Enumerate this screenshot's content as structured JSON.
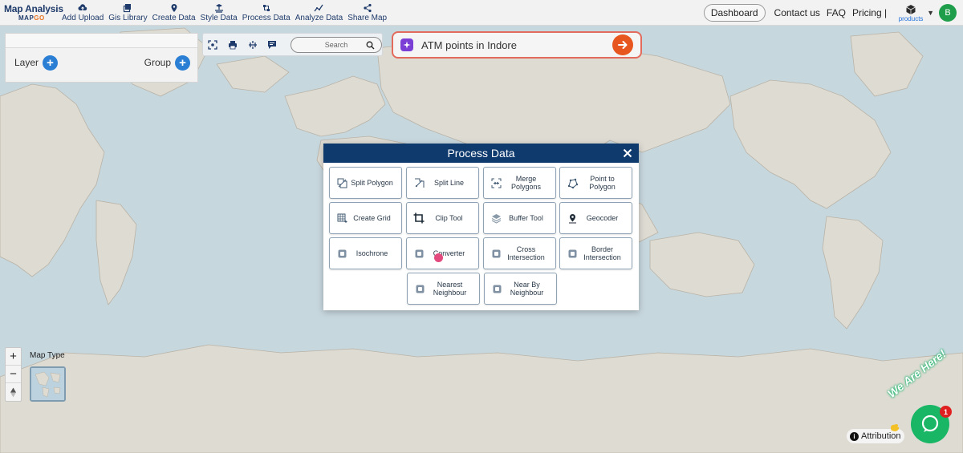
{
  "brand": {
    "name": "Map Analysis",
    "sub_a": "MAP",
    "sub_b": "GO"
  },
  "nav": [
    {
      "label": "Add Upload",
      "icon": "cloud-upload-icon"
    },
    {
      "label": "Gis Library",
      "icon": "layers-icon"
    },
    {
      "label": "Create Data",
      "icon": "map-pin-icon"
    },
    {
      "label": "Style Data",
      "icon": "paint-icon"
    },
    {
      "label": "Process Data",
      "icon": "process-icon"
    },
    {
      "label": "Analyze Data",
      "icon": "analyze-icon"
    },
    {
      "label": "Share Map",
      "icon": "share-icon"
    }
  ],
  "nav_right": {
    "dashboard": "Dashboard",
    "contact": "Contact us",
    "faq": "FAQ",
    "pricing": "Pricing |",
    "products": "products",
    "avatar_initial": "B"
  },
  "layer_panel": {
    "layer_label": "Layer",
    "group_label": "Group"
  },
  "toolbar": {
    "search_placeholder": "Search"
  },
  "ai_bar": {
    "text": "ATM points in Indore"
  },
  "modal": {
    "title": "Process Data",
    "tools": [
      {
        "label": "Split Polygon",
        "icon": "split-polygon-icon"
      },
      {
        "label": "Split Line",
        "icon": "split-line-icon"
      },
      {
        "label": "Merge Polygons",
        "icon": "merge-polygons-icon"
      },
      {
        "label": "Point to Polygon",
        "icon": "point-to-polygon-icon"
      },
      {
        "label": "Create Grid",
        "icon": "grid-icon"
      },
      {
        "label": "Clip Tool",
        "icon": "crop-icon"
      },
      {
        "label": "Buffer Tool",
        "icon": "buffer-icon"
      },
      {
        "label": "Geocoder",
        "icon": "geocoder-pin-icon"
      },
      {
        "label": "Isochrone",
        "icon": "isochrone-icon"
      },
      {
        "label": "Converter",
        "icon": "converter-icon"
      },
      {
        "label": "Cross Intersection",
        "icon": "cross-intersection-icon"
      },
      {
        "label": "Border Intersection",
        "icon": "border-intersection-icon"
      },
      {
        "label": "Nearest Neighbour",
        "icon": "nearest-neighbour-icon"
      },
      {
        "label": "Near By Neighbour",
        "icon": "nearby-neighbour-icon"
      }
    ]
  },
  "map_controls": {
    "zoom_in": "+",
    "zoom_out": "−",
    "map_type_label": "Map Type"
  },
  "attribution": "Attribution",
  "chat": {
    "badge": "1",
    "banner": "We Are Here!"
  },
  "colors": {
    "navy": "#0e3a6e",
    "accent_orange": "#e8561f",
    "chat_green": "#19b665",
    "ai_purple": "#7b3fd6"
  }
}
